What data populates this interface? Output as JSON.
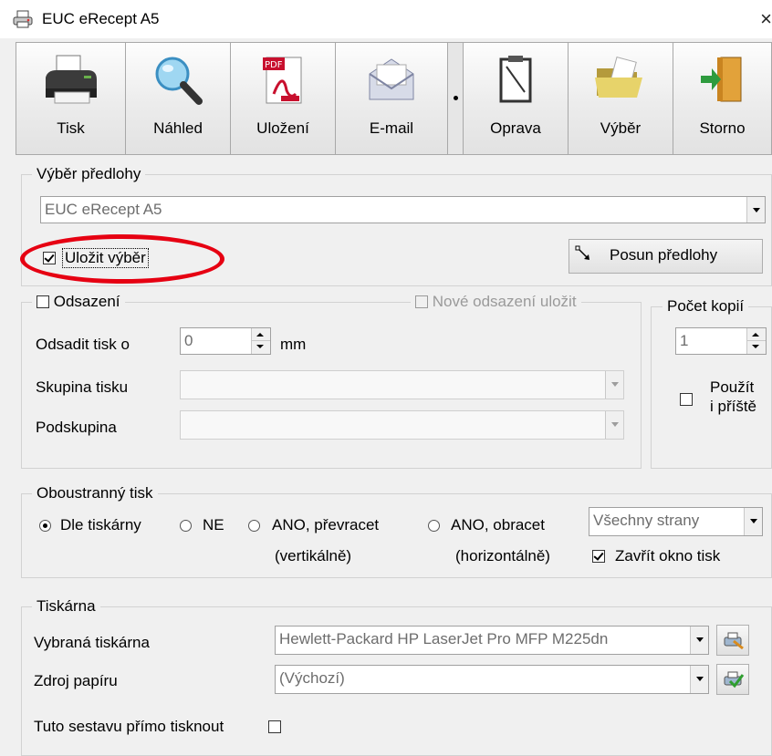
{
  "window": {
    "title": "EUC eRecept A5",
    "close_label": "×"
  },
  "toolbar": {
    "buttons": [
      {
        "label": "Tisk",
        "icon": "printer-icon"
      },
      {
        "label": "Náhled",
        "icon": "magnifier-icon"
      },
      {
        "label": "Uložení",
        "icon": "pdf-icon"
      },
      {
        "label": "E-mail",
        "icon": "envelope-icon"
      },
      {
        "label": "Oprava",
        "icon": "clipboard-edit-icon"
      },
      {
        "label": "Výběr",
        "icon": "folder-icon"
      },
      {
        "label": "Storno",
        "icon": "exit-door-icon"
      }
    ]
  },
  "template_group": {
    "legend": "Výběr předlohy",
    "selected_template": "EUC eRecept A5",
    "save_selection_label": "Uložit výběr",
    "save_selection_checked": true,
    "shift_button_label": "Posun předlohy"
  },
  "offset_group": {
    "legend": "Odsazení",
    "legend_checked": false,
    "save_new_offset_label": "Nové odsazení uložit",
    "offset_label": "Odsadit tisk o",
    "offset_value": "0",
    "offset_unit": "mm",
    "print_group_label": "Skupina tisku",
    "print_group_value": "",
    "subgroup_label": "Podskupina",
    "subgroup_value": ""
  },
  "copies_group": {
    "legend": "Počet kopií",
    "value": "1",
    "use_next_label_line1": "Použít",
    "use_next_label_line2": "i příště",
    "use_next_checked": false
  },
  "duplex_group": {
    "legend": "Oboustranný tisk",
    "options": [
      {
        "label": "Dle tiskárny",
        "selected": true
      },
      {
        "label": "NE",
        "selected": false
      },
      {
        "label": "ANO, převracet",
        "sublabel": "(vertikálně)",
        "selected": false
      },
      {
        "label": "ANO, obracet",
        "sublabel": "(horizontálně)",
        "selected": false
      }
    ],
    "pages_value": "Všechny strany",
    "close_window_label": "Zavřít okno tisk",
    "close_window_checked": true
  },
  "printer_group": {
    "legend": "Tiskárna",
    "selected_printer_label": "Vybraná tiskárna",
    "selected_printer_value": "Hewlett-Packard HP LaserJet Pro MFP M225dn",
    "paper_source_label": "Zdroj papíru",
    "paper_source_value": "(Výchozí)",
    "direct_print_label": "Tuto sestavu přímo tisknout",
    "direct_print_checked": false
  },
  "colors": {
    "annotation_red": "#e60012",
    "window_bg": "#f0f0f0"
  }
}
